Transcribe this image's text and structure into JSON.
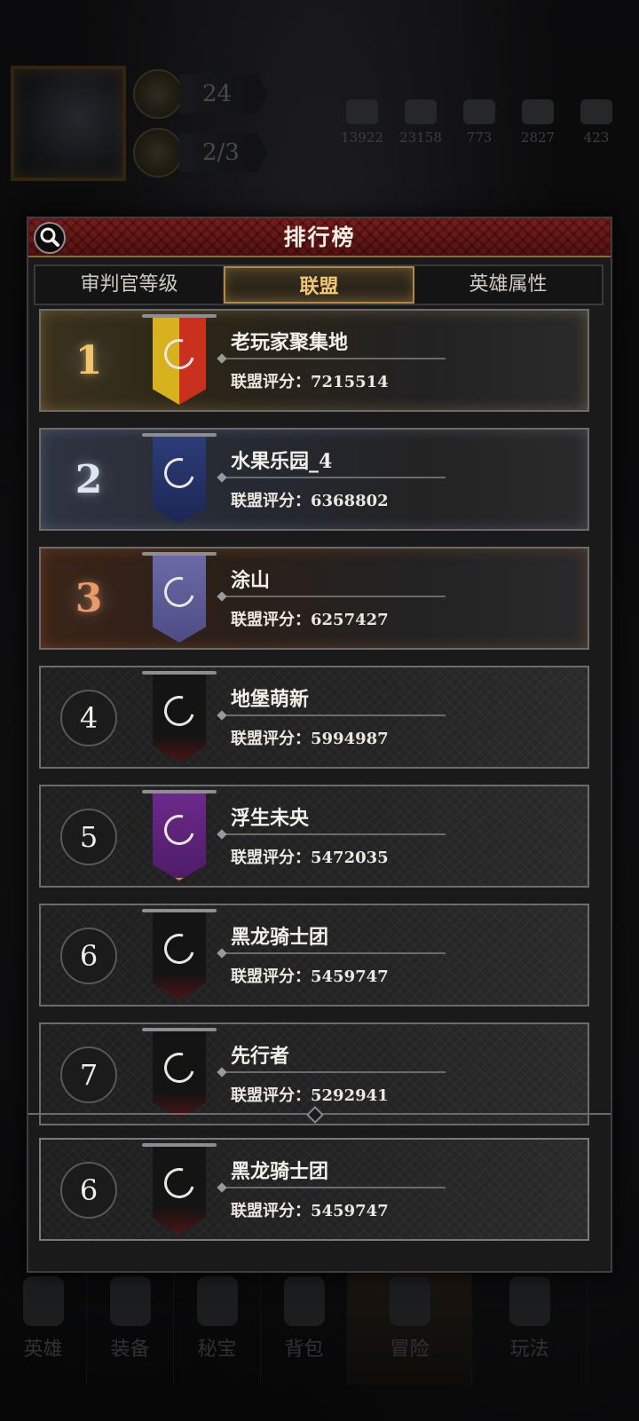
{
  "hud": {
    "stat_level": "24",
    "stat_count": "2/3",
    "resources": [
      "13922",
      "23158",
      "773",
      "2827",
      "423"
    ]
  },
  "bottom_nav": [
    "英雄",
    "装备",
    "秘宝",
    "背包",
    "冒险",
    "玩法"
  ],
  "panel": {
    "title": "排行榜",
    "tabs": [
      {
        "label": "审判官等级",
        "active": false
      },
      {
        "label": "联盟",
        "active": true
      },
      {
        "label": "英雄属性",
        "active": false
      }
    ],
    "score_label": "联盟评分：",
    "rows": [
      {
        "rank": "1",
        "name": "老玩家聚集地",
        "score": "7215514",
        "banner": "yellow-red"
      },
      {
        "rank": "2",
        "name": "水果乐园_4",
        "score": "6368802",
        "banner": "blue-tree"
      },
      {
        "rank": "3",
        "name": "涂山",
        "score": "6257427",
        "banner": "lavender"
      },
      {
        "rank": "4",
        "name": "地堡萌新",
        "score": "5994987",
        "banner": "black"
      },
      {
        "rank": "5",
        "name": "浮生未央",
        "score": "5472035",
        "banner": "purple-chalice"
      },
      {
        "rank": "6",
        "name": "黑龙骑士团",
        "score": "5459747",
        "banner": "black"
      },
      {
        "rank": "7",
        "name": "先行者",
        "score": "5292941",
        "banner": "black"
      }
    ],
    "my_row": {
      "rank": "6",
      "name": "黑龙骑士团",
      "score": "5459747",
      "banner": "black"
    }
  },
  "colors": {
    "header_red": "#6a1717",
    "active_tab_gold": "#f0c873",
    "rank1": "#f0c56b",
    "rank2": "#dfe6ef",
    "rank3": "#e89a6a"
  }
}
